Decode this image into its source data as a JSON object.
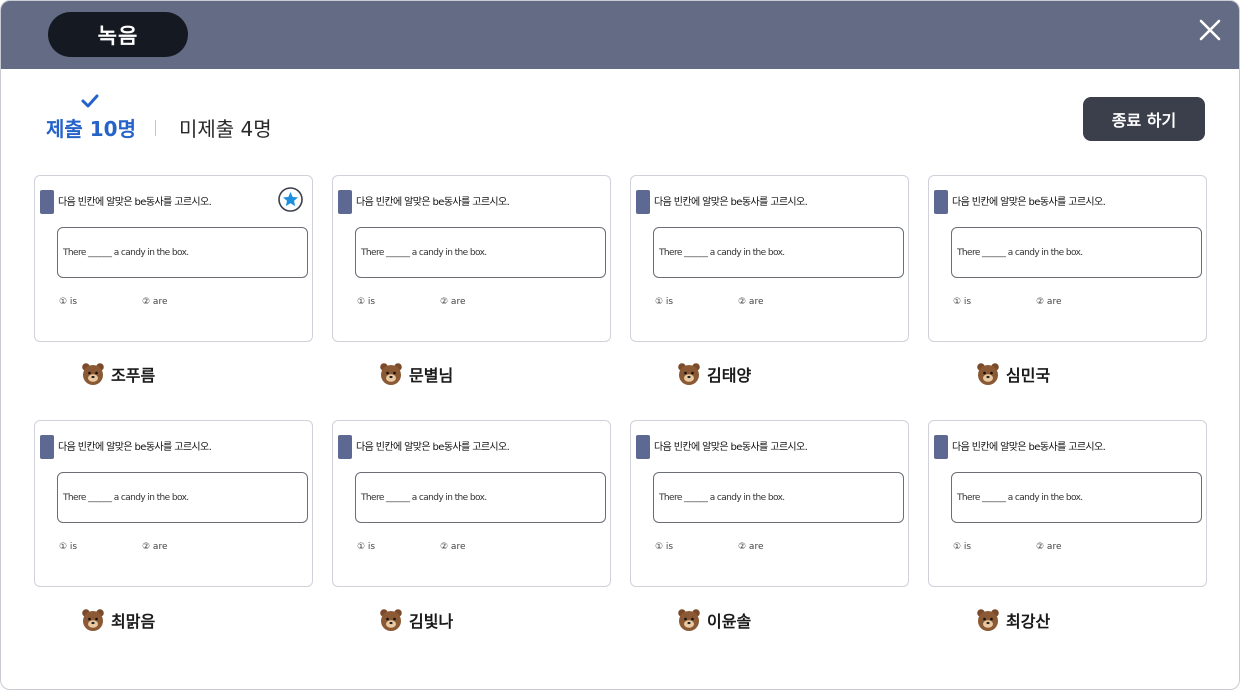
{
  "header": {
    "title": "녹음",
    "close_icon": "close-icon"
  },
  "tabs": {
    "submitted_label": "제출 10명",
    "unsubmitted_label": "미제출 4명"
  },
  "actions": {
    "end_label": "종료 하기"
  },
  "colors": {
    "header_bg": "#646c85",
    "accent": "#2563c9",
    "pill": "#151a22",
    "end_button": "#3a3f4b"
  },
  "question": {
    "instruction": "다음 빈칸에 알맞은 be동사를 고르시오.",
    "sentence": "There ______ a candy in the box.",
    "option1": "① is",
    "option2": "② are"
  },
  "submissions": [
    {
      "name": "조푸름",
      "starred": true
    },
    {
      "name": "문별님",
      "starred": false
    },
    {
      "name": "김태양",
      "starred": false
    },
    {
      "name": "심민국",
      "starred": false
    },
    {
      "name": "최맑음",
      "starred": false
    },
    {
      "name": "김빛나",
      "starred": false
    },
    {
      "name": "이윤솔",
      "starred": false
    },
    {
      "name": "최강산",
      "starred": false
    }
  ]
}
